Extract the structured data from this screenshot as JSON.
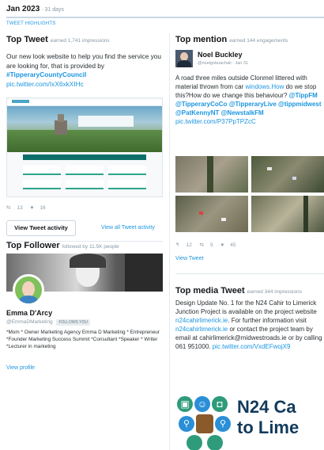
{
  "header": {
    "month": "Jan 2023",
    "sep": " · ",
    "days": "31 days",
    "highlights": "TWEET HIGHLIGHTS"
  },
  "top_tweet": {
    "title": "Top Tweet",
    "subtitle": "earned 1,741 impressions",
    "text1": "Our new look website to help you find the service you are looking for, that is provided by ",
    "hashtag": "#TipperaryCountyCouncil",
    "link": "pic.twitter.com/IxX6xkXIHc",
    "retweets": "13",
    "likes": "16",
    "button": "View Tweet activity",
    "all_link": "View all Tweet activity"
  },
  "top_mention": {
    "title": "Top mention",
    "subtitle": "earned 144 engagements",
    "name": "Noel Buckley",
    "handle": "@noelgobuachail · Jan 31",
    "text1": "A road three miles outside Clonmel littered with material thrown from car ",
    "link1": "windows.How",
    "text2": " do we stop this?How do we change this behaviour? ",
    "mentions": [
      "@TippFM",
      "@TipperaryCoCo",
      "@TipperaryLive",
      "@tippmidwest",
      "@PatKennyNT",
      "@NewstalkFM"
    ],
    "link2": "pic.twitter.com/P37PpTPZcC",
    "replies": "12",
    "retweets": "5",
    "likes": "45",
    "view": "View Tweet"
  },
  "top_follower": {
    "title": "Top Follower",
    "subtitle": "followed by 11.5K people",
    "name": "Emma D'Arcy",
    "handle": "@EmmaDMarketing",
    "follows_badge": "FOLLOWS YOU",
    "bio": "*Mom * Owner Marketing Agency Emma D Marketing * Entrepreneur *Founder Marketing Success Summit *Consultant *Speaker * Writer *Lecturer in marketing",
    "view": "View profile"
  },
  "top_media": {
    "title": "Top media Tweet",
    "subtitle": "earned 344 impressions",
    "text1": "Design Update No. 1 for the N24 Cahir to Limerick Junction Project is available on the project website ",
    "link1": "n24cahirlimerick.ie",
    "text2": ". For further information visit ",
    "link2": "n24cahirlimerick.ie",
    "text3": " or contact the project team by email at cahirlimerick@midwestroads.ie or by calling 061 951000. ",
    "link3": "pic.twitter.com/VxdEFwojX9",
    "banner_line1": "N24 Ca",
    "banner_line2": "to Lime"
  },
  "colors": {
    "link": "#1b95e0",
    "muted": "#8899a6",
    "text": "#14171a",
    "icon_green": "#2e9b7a",
    "icon_blue": "#2a8fd6"
  }
}
